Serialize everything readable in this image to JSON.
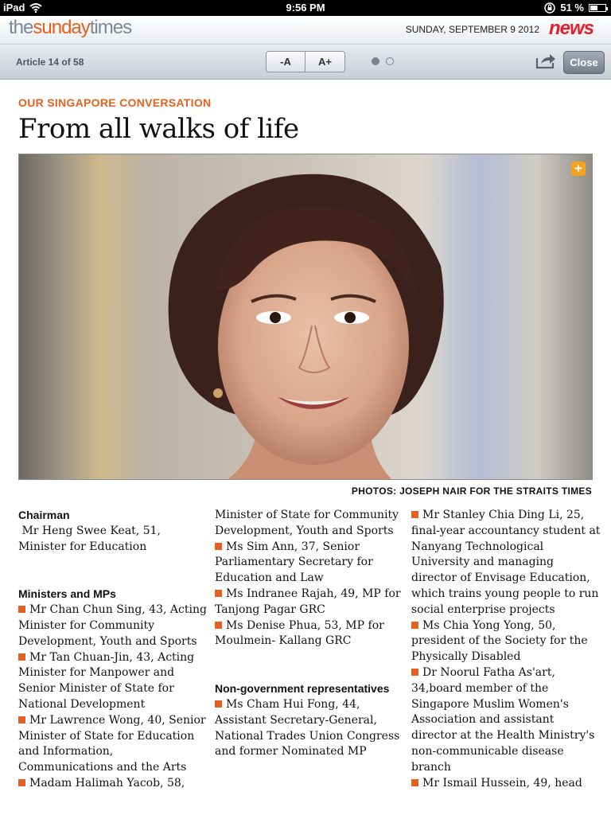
{
  "status_bar": {
    "device": "iPad",
    "time": "9:56 PM",
    "battery": "51 %"
  },
  "masthead": {
    "logo_pre": "the",
    "logo_mid": "sunday",
    "logo_post": "times",
    "date": "SUNDAY, SEPTEMBER 9 2012",
    "section": "news"
  },
  "toolbar": {
    "article_count": "Article 14 of 58",
    "font_smaller": "-A",
    "font_larger": "A+",
    "close_label": "Close"
  },
  "article": {
    "kicker": "OUR SINGAPORE CONVERSATION",
    "headline": "From all walks of life",
    "photo_credit": "PHOTOS: JOSEPH NAIR FOR THE STRAITS TIMES"
  },
  "columns": {
    "chairman_heading": "Chairman",
    "chairman_text": "Mr Heng Swee Keat, 51, Minister for Education",
    "ministers_heading": "Ministers and MPs",
    "ministers": [
      "Mr Chan Chun Sing, 43, Acting Minister for Community Development, Youth and Sports",
      "Mr Tan Chuan-Jin, 43, Acting Minister for Manpower and Senior Minister of State for National Development",
      "Mr Lawrence Wong, 40, Senior Minister of State for Education and Information, Communications and the Arts",
      "Madam Halimah Yacob, 58,"
    ],
    "col2_continuation": "Minister of State for Community Development, Youth and Sports",
    "col2_items": [
      "Ms Sim Ann, 37, Senior Parliamentary Secretary for Education and Law",
      "Ms Indranee Rajah, 49, MP for Tanjong Pagar GRC",
      "Ms Denise Phua, 53, MP for Moulmein- Kallang GRC"
    ],
    "nongov_heading": "Non-government representatives",
    "nongov_items": [
      "Ms Cham Hui Fong, 44, Assistant Secretary-General, National Trades Union Congress and former Nominated MP"
    ],
    "col3_items": [
      "Mr Stanley Chia Ding Li, 25, final-year accountancy student at Nanyang Technological University and managing director of Envisage Education, which trains young people to run social enterprise projects",
      "Ms Chia Yong Yong, 50, president of the Society for the Physically Disabled",
      "Dr Noorul Fatha As'art, 34,board member of the Singapore Muslim Women's Association and assistant director at the Health Ministry's non-communicable disease branch",
      "Mr Ismail Hussein, 49, head"
    ]
  }
}
